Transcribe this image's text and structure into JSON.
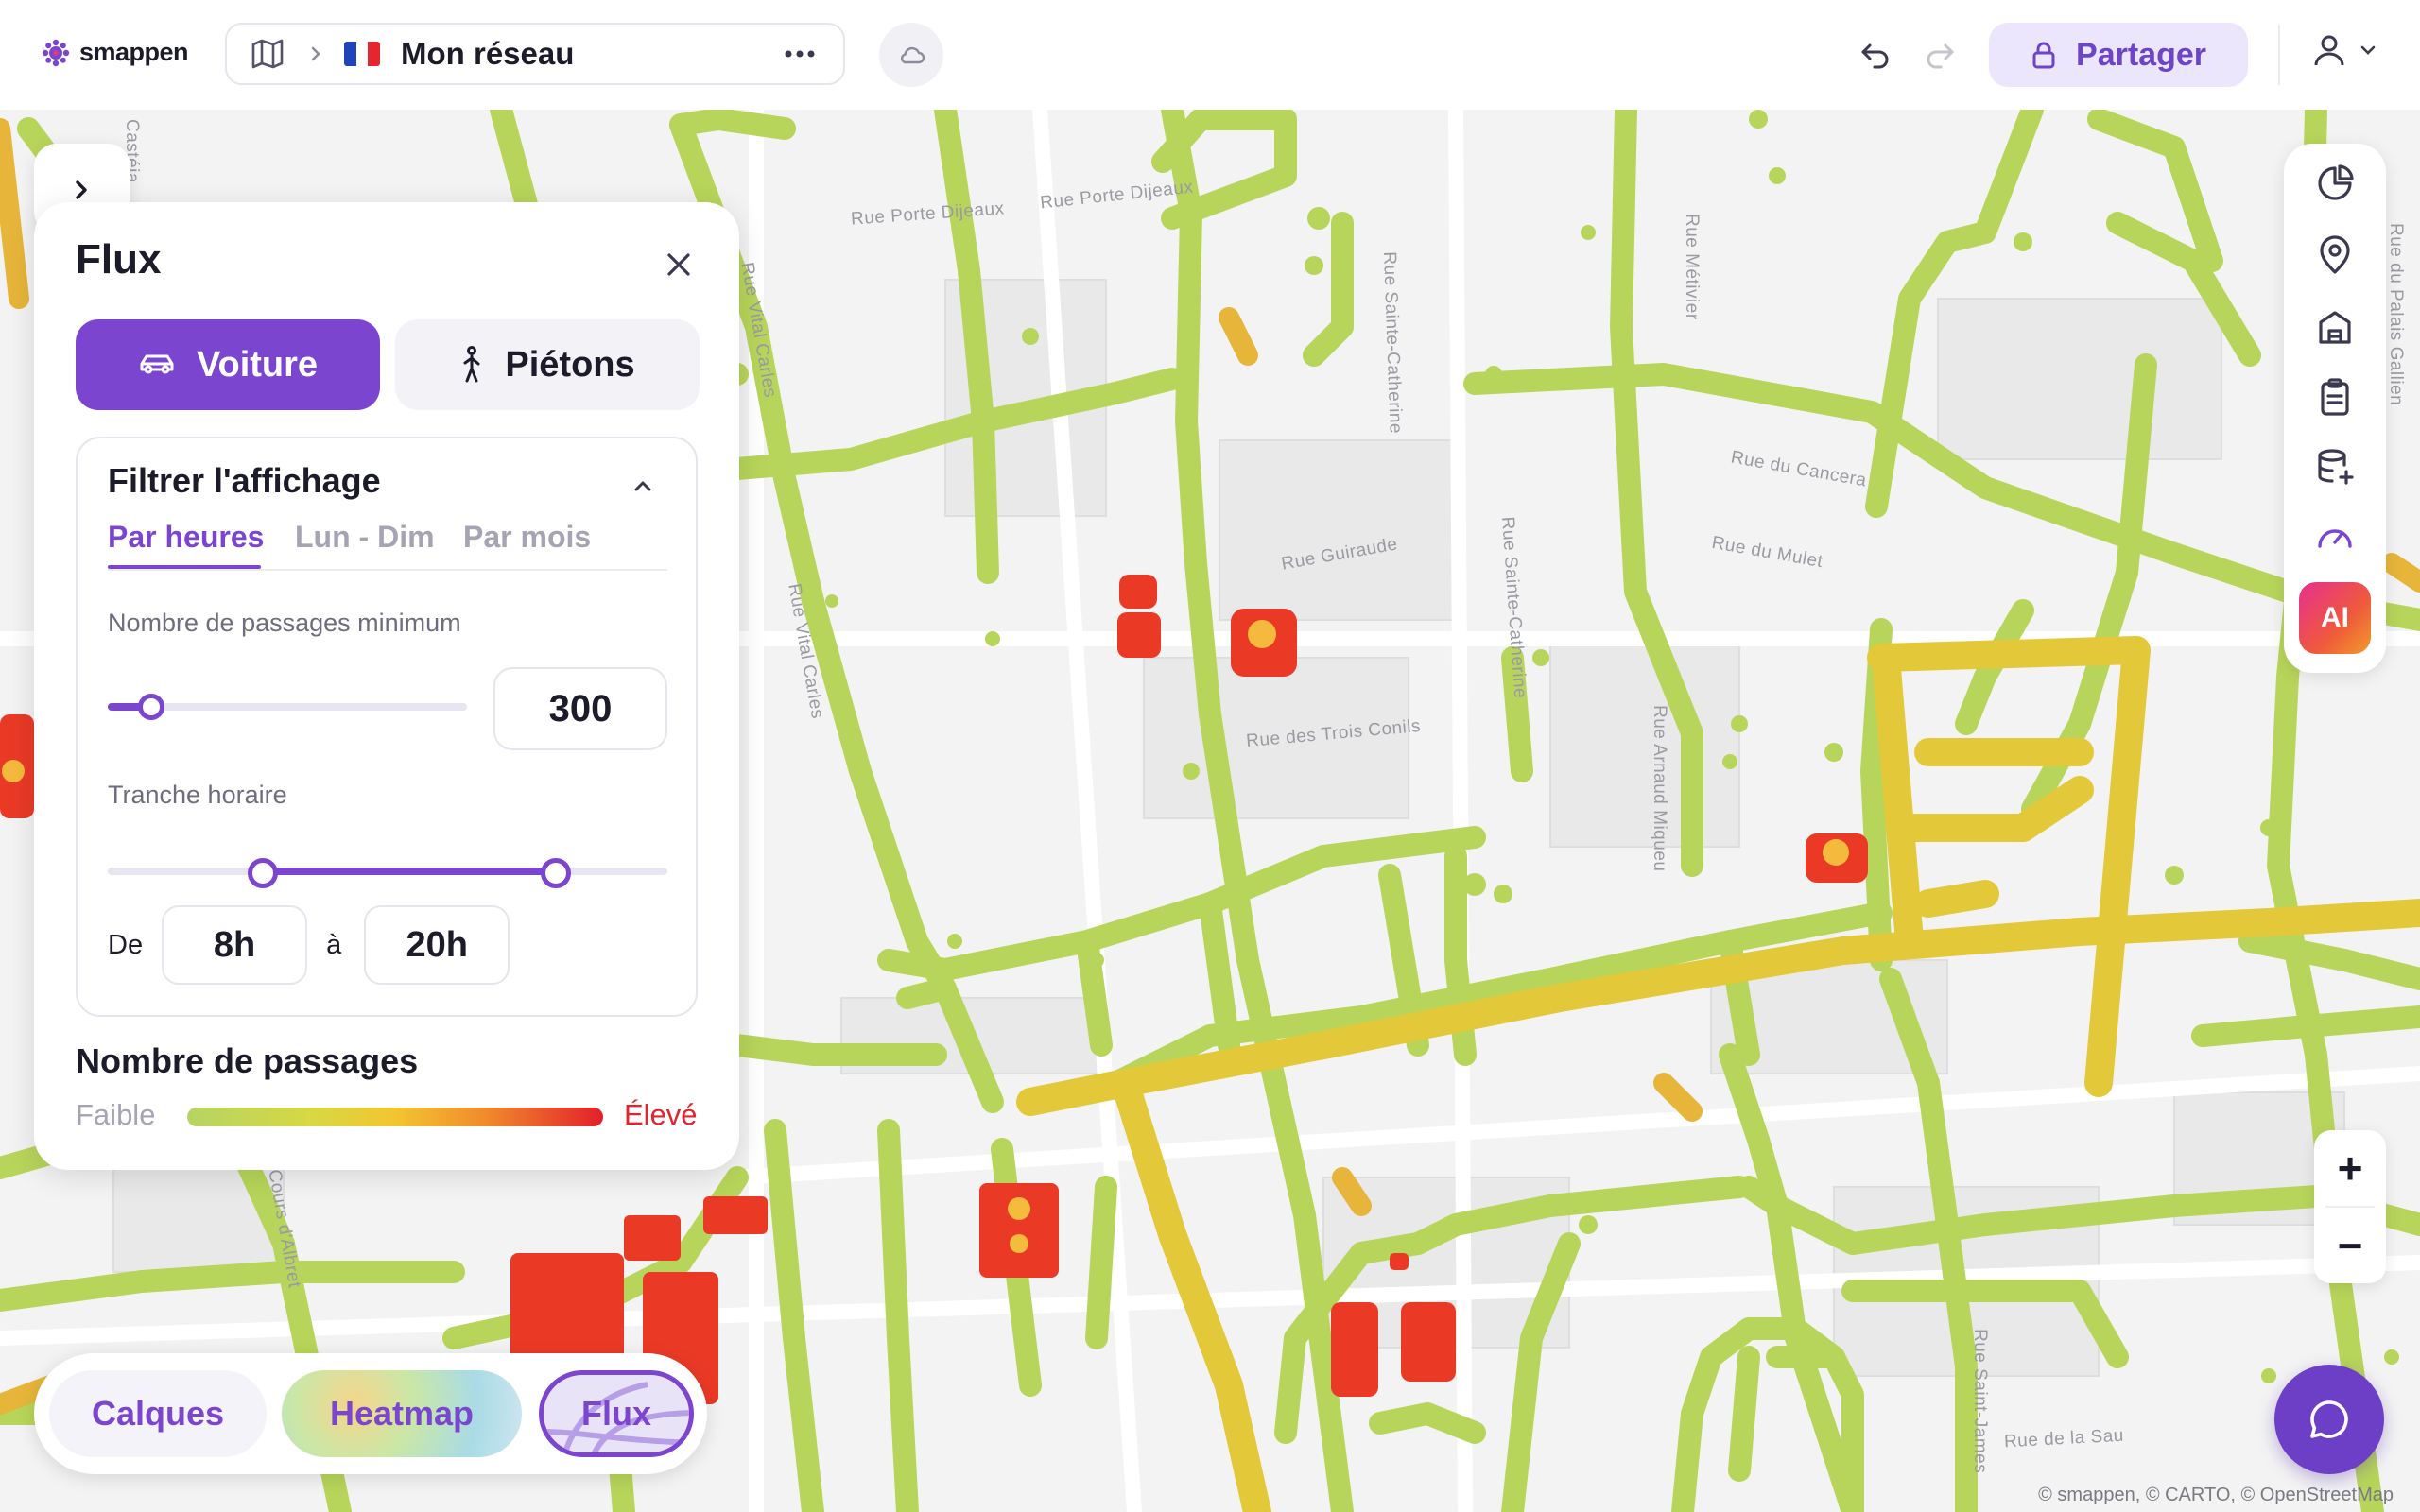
{
  "brand": {
    "name": "smappen",
    "accent": "#7b45cf"
  },
  "header": {
    "project_title": "Mon réseau",
    "flag": "FR",
    "share_label": "Partager"
  },
  "map": {
    "street_labels": [
      "Rue Porte Dijeaux",
      "Rue Porte Dijeaux",
      "Rue du Cancera",
      "Rue du Mulet",
      "Rue Guiraude",
      "Rue des Trois Conils",
      "Rue Sainte-Catherine",
      "Rue Sainte-Catherine",
      "Rue Arnaud Miqueu",
      "Rue Métivier",
      "Rue Vital Carles",
      "Rue Vital Carles",
      "Cours d'Albret",
      "Rue Saint-James",
      "Rue de la Sau",
      "Castéja",
      "Rue du Palais Gallien"
    ],
    "attribution": "© smappen, © CARTO, © OpenStreetMap",
    "flow_colors": {
      "low": "#b6d463",
      "mid": "#f3c531",
      "high": "#e2202a"
    }
  },
  "panel": {
    "title": "Flux",
    "modes": [
      {
        "label": "Voiture",
        "icon": "car-icon",
        "active": true
      },
      {
        "label": "Piétons",
        "icon": "pedestrian-icon",
        "active": false
      }
    ],
    "filter": {
      "title": "Filtrer l'affichage",
      "tabs": [
        "Par heures",
        "Lun - Dim",
        "Par mois"
      ],
      "active_tab": "Par heures",
      "min_passages_label": "Nombre de passages minimum",
      "min_passages_value": "300",
      "time_range_label": "Tranche horaire",
      "from_label": "De",
      "from_value": "8h",
      "to_label": "à",
      "to_value": "20h"
    },
    "legend": {
      "title": "Nombre de passages",
      "low": "Faible",
      "high": "Élevé"
    }
  },
  "right_toolbar": {
    "icons": [
      "pie-chart-icon",
      "map-pin-icon",
      "building-icon",
      "clipboard-icon",
      "database-add-icon",
      "gauge-icon"
    ],
    "ai_label": "AI"
  },
  "zoom": {
    "in": "+",
    "out": "−"
  },
  "layers": {
    "items": [
      "Calques",
      "Heatmap",
      "Flux"
    ],
    "active": "Flux"
  }
}
